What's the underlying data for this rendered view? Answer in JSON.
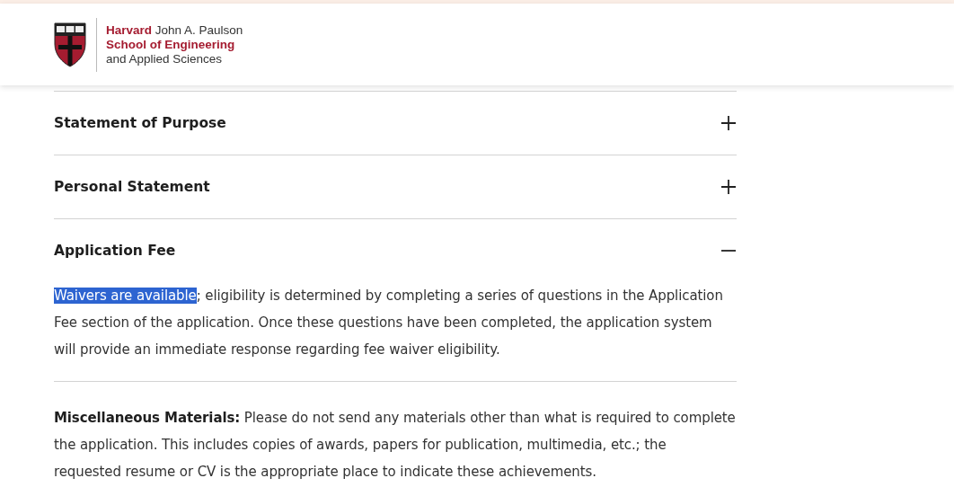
{
  "logo": {
    "line_1": "**Harvard** John A. Paulson",
    "line_2": "School of Engineering",
    "line_3": "and Applied Sciences"
  },
  "accordion": [
    {
      "title": "Statement of Purpose",
      "expanded": false
    },
    {
      "title": "Personal Statement",
      "expanded": false
    },
    {
      "title": "Application Fee",
      "expanded": true,
      "body": {
        "selected_text": "Waivers are available",
        "text": "; eligibility is determined by completing a series of questions in the Application Fee section of the application. Once these questions have been completed, the application system will provide an immediate response regarding fee waiver eligibility."
      }
    }
  ],
  "note": "**Miscellaneous Materials:** Please do not send any materials other than what is required to complete the application. This includes copies of awards, papers for publication, multimedia, etc.; the requested resume or CV is the appropriate place to indicate these achievements."
}
